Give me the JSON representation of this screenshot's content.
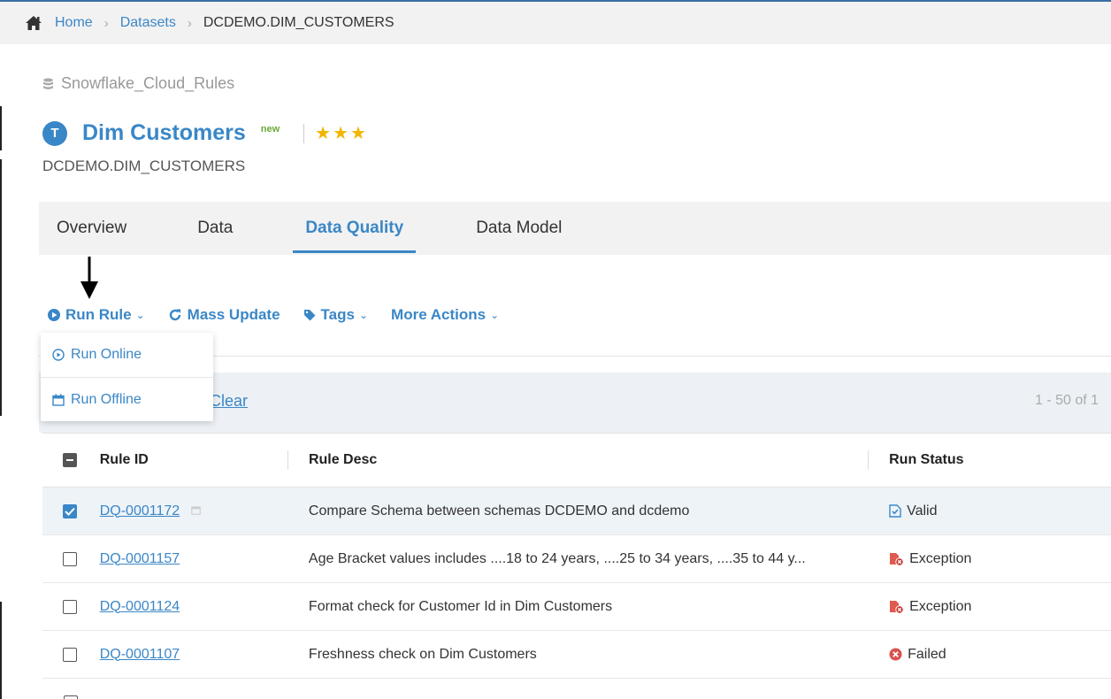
{
  "breadcrumb": {
    "home": "Home",
    "datasets": "Datasets",
    "current": "DCDEMO.DIM_CUSTOMERS"
  },
  "source": {
    "name": "Snowflake_Cloud_Rules"
  },
  "dataset": {
    "type_letter": "T",
    "title": "Dim Customers",
    "new_label": "new",
    "stars": "★★★",
    "subtitle": "DCDEMO.DIM_CUSTOMERS"
  },
  "tabs": [
    {
      "label": "Overview"
    },
    {
      "label": "Data"
    },
    {
      "label": "Data Quality"
    },
    {
      "label": "Data Model"
    }
  ],
  "active_tab": "Data Quality",
  "toolbar": {
    "run_rule": "Run Rule",
    "mass_update": "Mass Update",
    "tags": "Tags",
    "more_actions": "More Actions"
  },
  "dropdown": {
    "run_online": "Run Online",
    "run_offline": "Run Offline"
  },
  "filter": {
    "clear": "Clear",
    "pager": "1 - 50 of 1"
  },
  "table": {
    "headers": {
      "rule_id": "Rule ID",
      "rule_desc": "Rule Desc",
      "run_status": "Run Status"
    },
    "rows": [
      {
        "id": "DQ-0001172",
        "desc": "Compare Schema between schemas DCDEMO and dcdemo",
        "status": "Valid",
        "checked": true
      },
      {
        "id": "DQ-0001157",
        "desc": "Age Bracket values includes ....18 to 24 years, ....25 to 34 years, ....35 to 44 y...",
        "status": "Exception",
        "checked": false
      },
      {
        "id": "DQ-0001124",
        "desc": "Format check for Customer Id in Dim Customers",
        "status": "Exception",
        "checked": false
      },
      {
        "id": "DQ-0001107",
        "desc": "Freshness check on Dim Customers",
        "status": "Failed",
        "checked": false
      }
    ]
  },
  "colors": {
    "accent": "#3a87c7",
    "star": "#f2b500",
    "new": "#6aaa3a",
    "exception": "#d9534f",
    "failed": "#d9534f"
  },
  "icons": [
    "home-icon",
    "database-icon",
    "play-circle-icon",
    "refresh-icon",
    "tag-icon",
    "calendar-icon",
    "valid-doc-icon",
    "exception-doc-icon",
    "failed-x-icon"
  ]
}
